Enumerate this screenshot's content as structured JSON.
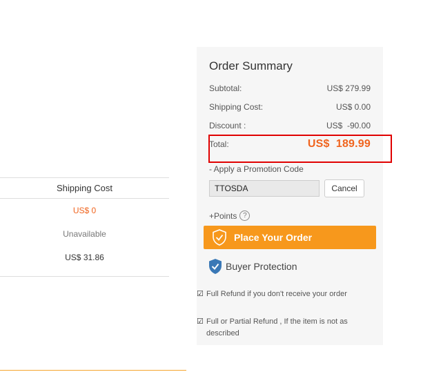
{
  "shipping_table": {
    "header": "Shipping Cost",
    "rows": [
      "US$ 0",
      "Unavailable",
      "US$ 31.86"
    ]
  },
  "summary": {
    "title": "Order Summary",
    "subtotal_label": "Subtotal:",
    "subtotal_value": "US$ 279.99",
    "shipping_label": "Shipping Cost:",
    "shipping_value": "US$ 0.00",
    "discount_label": "Discount :",
    "discount_value": "US$  -90.00",
    "total_label": "Total:",
    "total_value": "US$  189.99"
  },
  "promo": {
    "label": "- Apply a Promotion Code",
    "code_value": "TTOSDA",
    "cancel_label": "Cancel"
  },
  "points_label": "+Points",
  "help_icon": "question-circle-icon",
  "place_order_label": "Place Your Order",
  "buyer_protection": {
    "title": "Buyer Protection",
    "items": [
      "Full Refund if you don't receive your order",
      "Full or Partial Refund , If the item is not as described"
    ]
  },
  "colors": {
    "accent_orange": "#f7981c",
    "total_red": "#f0641e",
    "highlight_border": "#e00000",
    "shield_blue": "#3a78b6"
  }
}
